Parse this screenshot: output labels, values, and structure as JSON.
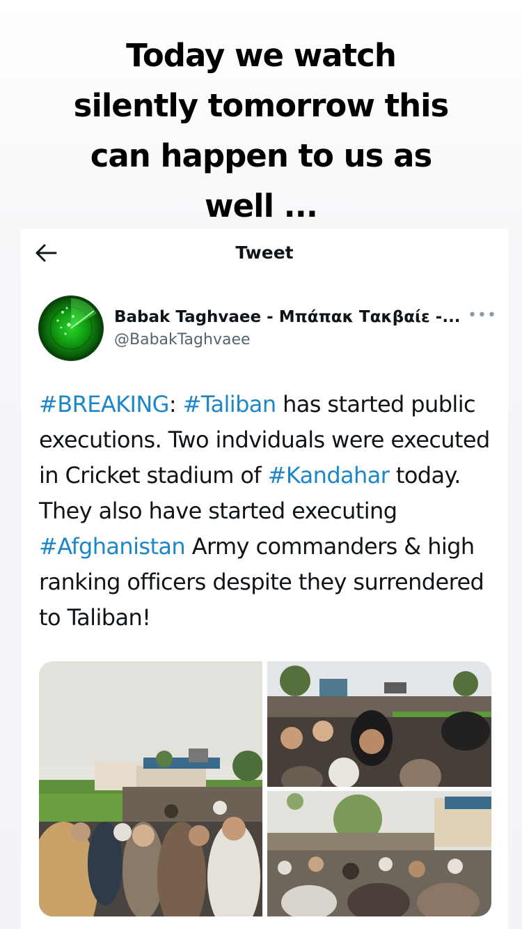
{
  "caption": {
    "line1": "Today we watch",
    "line2": "silently tomorrow this",
    "line3": "can happen to us as",
    "line4": "well ..."
  },
  "header": {
    "title": "Tweet",
    "back_icon": "arrow-left-icon"
  },
  "tweet": {
    "author_name": "Babak Taghvaee - Μπάπακ Τακβαίε -...",
    "author_handle": "@BabakTaghvaee",
    "more_icon": "more-horizontal-icon",
    "text_parts": [
      {
        "text": "#BREAKING",
        "hashtag": true
      },
      {
        "text": ": ",
        "hashtag": false
      },
      {
        "text": "#Taliban",
        "hashtag": true
      },
      {
        "text": " has started public executions. Two indviduals were executed in Cricket stadium of ",
        "hashtag": false
      },
      {
        "text": "#Kandahar",
        "hashtag": true
      },
      {
        "text": " today. They also have started executing ",
        "hashtag": false
      },
      {
        "text": "#Afghanistan",
        "hashtag": true
      },
      {
        "text": " Army commanders & high ranking officers despite they surrendered to Taliban!",
        "hashtag": false
      }
    ],
    "media": {
      "photo_count": 3
    }
  },
  "colors": {
    "hashtag": "#1d86c7",
    "text": "#0f1419",
    "secondary": "#536471"
  }
}
